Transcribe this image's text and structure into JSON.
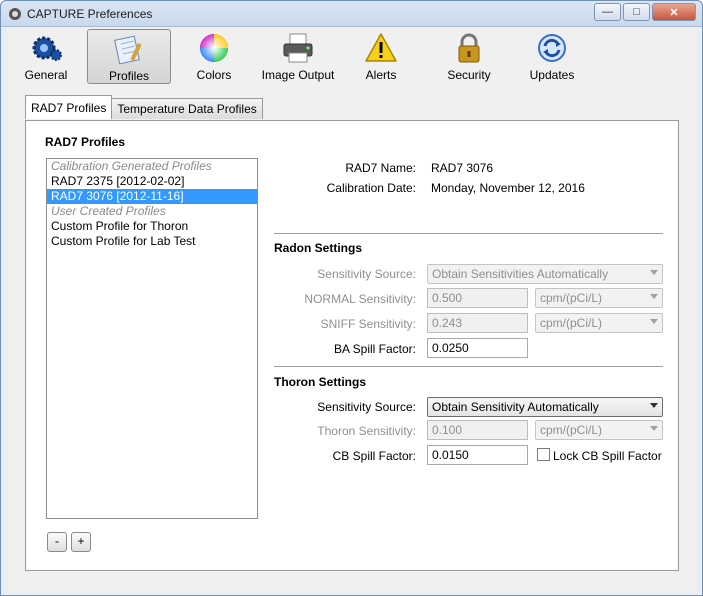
{
  "window": {
    "title": "CAPTURE Preferences"
  },
  "toolbar": [
    {
      "label": "General",
      "icon": "gear-icon"
    },
    {
      "label": "Profiles",
      "icon": "notepad-icon"
    },
    {
      "label": "Colors",
      "icon": "color-wheel-icon"
    },
    {
      "label": "Image Output",
      "icon": "printer-icon"
    },
    {
      "label": "Alerts",
      "icon": "warning-icon"
    },
    {
      "label": "Security",
      "icon": "padlock-icon"
    },
    {
      "label": "Updates",
      "icon": "refresh-icon"
    }
  ],
  "tabs": [
    {
      "label": "RAD7 Profiles",
      "active": true
    },
    {
      "label": "Temperature Data Profiles",
      "active": false
    }
  ],
  "profiles": {
    "title": "RAD7 Profiles",
    "list": [
      {
        "text": "Calibration Generated Profiles",
        "group": true
      },
      {
        "text": "RAD7 2375 [2012-02-02]"
      },
      {
        "text": "RAD7 3076 [2012-11-16]",
        "selected": true
      },
      {
        "text": "User Created Profiles",
        "group": true
      },
      {
        "text": "Custom Profile for Thoron"
      },
      {
        "text": "Custom Profile for Lab Test"
      }
    ],
    "remove_label": "-",
    "add_label": "+"
  },
  "details": {
    "name_label": "RAD7 Name:",
    "name_value": "RAD7 3076",
    "cal_label": "Calibration Date:",
    "cal_value": "Monday, November 12, 2016"
  },
  "radon": {
    "title": "Radon Settings",
    "source_label": "Sensitivity Source:",
    "source_value": "Obtain Sensitivities Automatically",
    "normal_label": "NORMAL Sensitivity:",
    "normal_value": "0.500",
    "normal_unit": "cpm/(pCi/L)",
    "sniff_label": "SNIFF Sensitivity:",
    "sniff_value": "0.243",
    "sniff_unit": "cpm/(pCi/L)",
    "ba_label": "BA Spill Factor:",
    "ba_value": "0.0250"
  },
  "thoron": {
    "title": "Thoron Settings",
    "source_label": "Sensitivity Source:",
    "source_value": "Obtain Sensitivity Automatically",
    "sens_label": "Thoron Sensitivity:",
    "sens_value": "0.100",
    "sens_unit": "cpm/(pCi/L)",
    "cb_label": "CB Spill Factor:",
    "cb_value": "0.0150",
    "lock_label": "Lock CB Spill Factor",
    "lock_checked": false
  }
}
